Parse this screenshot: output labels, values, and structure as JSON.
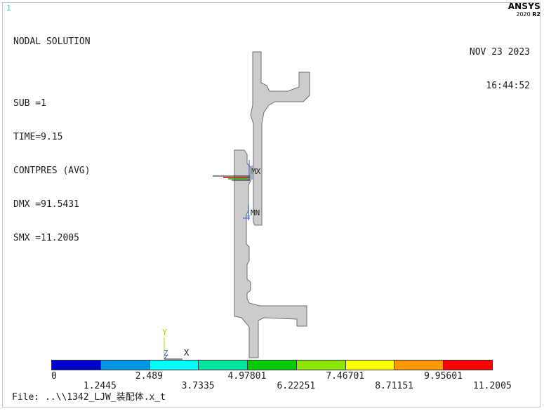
{
  "window_number": "1",
  "header": {
    "title": "NODAL SOLUTION",
    "lines": [
      "SUB =1",
      "TIME=9.15",
      "CONTPRES (AVG)",
      "DMX =91.5431",
      "SMX =11.2005"
    ]
  },
  "date": "NOV 23 2023",
  "time": "16:44:52",
  "logo": {
    "name": "ANSYS",
    "version": "2020",
    "release": "R2"
  },
  "markers": {
    "max": "MX",
    "min": "MN"
  },
  "triad": {
    "y": "Y",
    "z": "Z",
    "x": "X"
  },
  "legend": {
    "colors": [
      "#0000cc",
      "#0096e6",
      "#00ffff",
      "#00e6a0",
      "#00cc00",
      "#8ce600",
      "#ffff00",
      "#ff9900",
      "#ff0000"
    ],
    "top_labels": [
      "0",
      "2.489",
      "4.97801",
      "7.46701",
      "9.95601"
    ],
    "bottom_labels": [
      "1.2445",
      "3.7335",
      "6.22251",
      "8.71151",
      "11.2005"
    ]
  },
  "file_label": "File: ..\\\\1342_LJW_装配体.x_t"
}
